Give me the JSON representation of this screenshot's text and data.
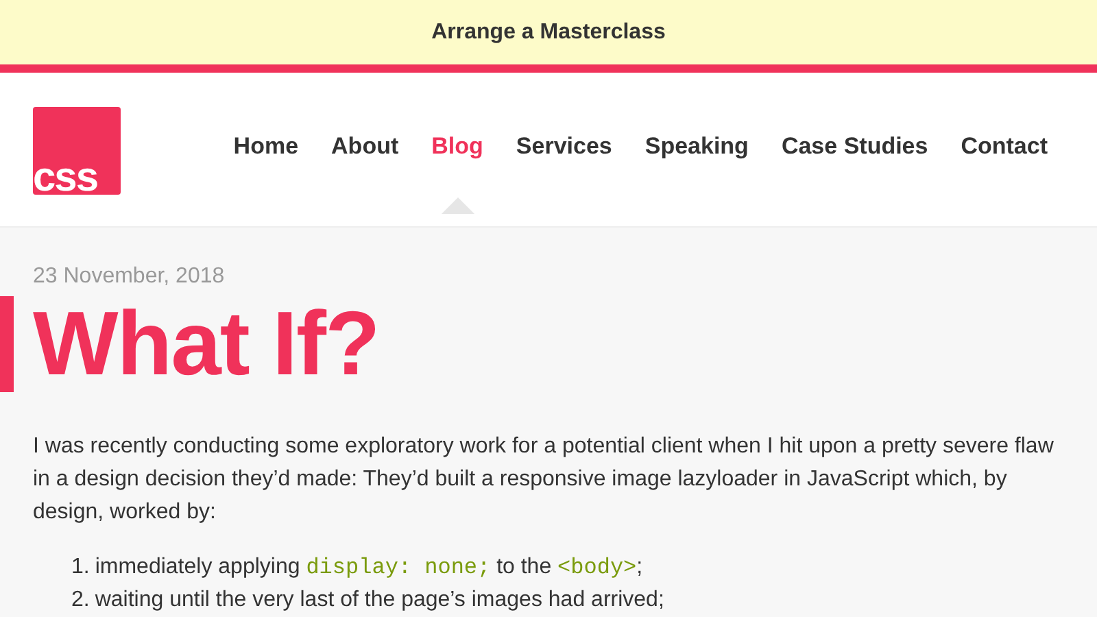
{
  "banner": {
    "label": "Arrange a Masterclass"
  },
  "logo": {
    "text": "css"
  },
  "nav": [
    {
      "label": "Home",
      "selected": false
    },
    {
      "label": "About",
      "selected": false
    },
    {
      "label": "Blog",
      "selected": true
    },
    {
      "label": "Services",
      "selected": false
    },
    {
      "label": "Speaking",
      "selected": false
    },
    {
      "label": "Case Studies",
      "selected": false
    },
    {
      "label": "Contact",
      "selected": false
    }
  ],
  "article": {
    "date": "23 November, 2018",
    "title": "What If?",
    "paragraph": "I was recently conducting some exploratory work for a potential client when I hit upon a pretty severe flaw in a design decision they’d made: They’d built a responsive image lazyloader in JavaScript which, by design, worked by:",
    "list": [
      {
        "number": "1.",
        "parts": [
          {
            "kind": "text",
            "text": "immediately applying "
          },
          {
            "kind": "code",
            "text": "display: none;"
          },
          {
            "kind": "text",
            "text": " to the "
          },
          {
            "kind": "code",
            "text": "<body>"
          },
          {
            "kind": "text",
            "text": ";"
          }
        ]
      },
      {
        "number": "2.",
        "parts": [
          {
            "kind": "text",
            "text": "waiting until the very last of the page’s images had arrived;"
          }
        ]
      }
    ]
  }
}
